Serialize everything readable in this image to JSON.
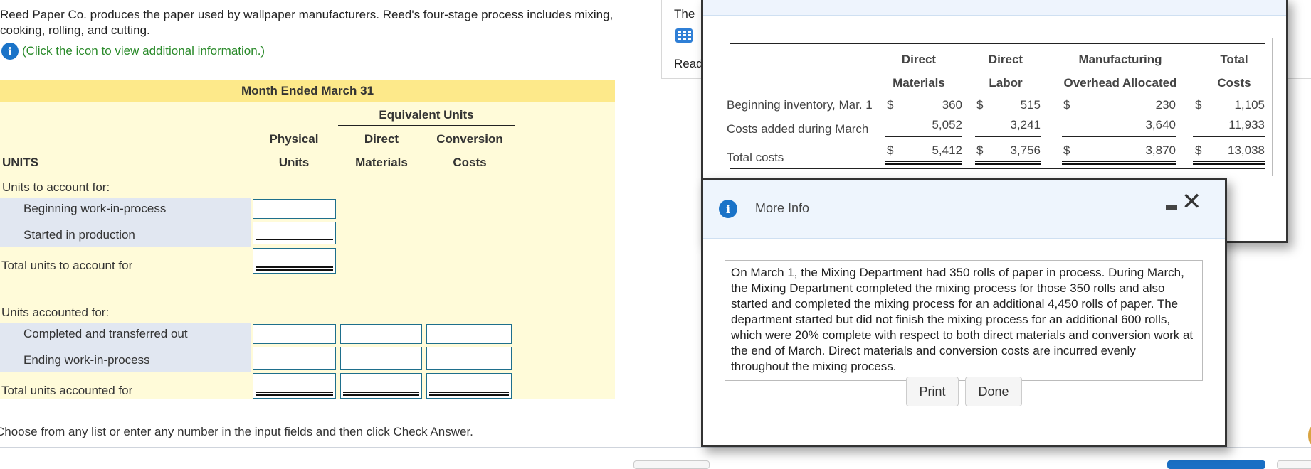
{
  "question": {
    "text": "Reed Paper Co. produces the paper used by wallpaper manufacturers. Reed's four-stage process includes mixing, cooking, rolling, and cutting.",
    "info_link": "(Click the icon to view additional information.)",
    "side_text_1": "The",
    "side_text_2": "Read"
  },
  "worksheet": {
    "period": "Month Ended March 31",
    "group_header": "Equivalent Units",
    "columns": [
      {
        "line1": "Physical",
        "line2": "Units"
      },
      {
        "line1": "Direct",
        "line2": "Materials"
      },
      {
        "line1": "Conversion",
        "line2": "Costs"
      }
    ],
    "section_label": "UNITS",
    "to_account_header": "Units to account for:",
    "rows_to_account": [
      "Beginning work-in-process",
      "Started in production"
    ],
    "total_to_account": "Total units to account for",
    "accounted_header": "Units accounted for:",
    "rows_accounted": [
      "Completed and transferred out",
      "Ending work-in-process"
    ],
    "total_accounted": "Total units accounted for",
    "input_values": {
      "beginning_wip_physical": "",
      "started_physical": "",
      "total_to_account_physical": "",
      "completed_physical": "",
      "completed_dm": "",
      "completed_cc": "",
      "ending_physical": "",
      "ending_dm": "",
      "ending_cc": "",
      "total_accounted_physical": "",
      "total_accounted_dm": "",
      "total_accounted_cc": ""
    }
  },
  "footer": {
    "instruction": "Choose from any list or enter any number in the input fields and then click Check Answer."
  },
  "cost_table": {
    "headers": [
      {
        "line1": "Direct",
        "line2": "Materials"
      },
      {
        "line1": "Direct",
        "line2": "Labor"
      },
      {
        "line1": "Manufacturing",
        "line2": "Overhead Allocated"
      },
      {
        "line1": "Total",
        "line2": "Costs"
      }
    ],
    "currency": "$",
    "rows": [
      {
        "label": "Beginning inventory, Mar. 1",
        "values": [
          "360",
          "515",
          "230",
          "1,105"
        ]
      },
      {
        "label": "Costs added during March",
        "values": [
          "5,052",
          "3,241",
          "3,640",
          "11,933"
        ]
      },
      {
        "label": "Total costs",
        "values": [
          "5,412",
          "3,756",
          "3,870",
          "13,038"
        ]
      }
    ]
  },
  "more_info": {
    "title": "More Info",
    "text": "On March 1, the Mixing Department had 350 rolls of paper in process. During March, the Mixing Department completed the mixing process for those 350 rolls and also started and completed the mixing process for an additional 4,450 rolls of paper. The department started but did not finish the mixing process for an additional 600 rolls, which were 20% complete with respect to both direct materials and conversion work at the end of March. Direct materials and conversion costs are incurred evenly throughout the mixing process.",
    "print_label": "Print",
    "done_label": "Done"
  },
  "colors": {
    "sheet_bg": "#fffbd9",
    "sheet_header": "#fde98a",
    "row_band": "#e1e7f1",
    "input_border": "#1e6f8c",
    "info_green": "#2a8a2a",
    "info_blue": "#1a73c8"
  }
}
